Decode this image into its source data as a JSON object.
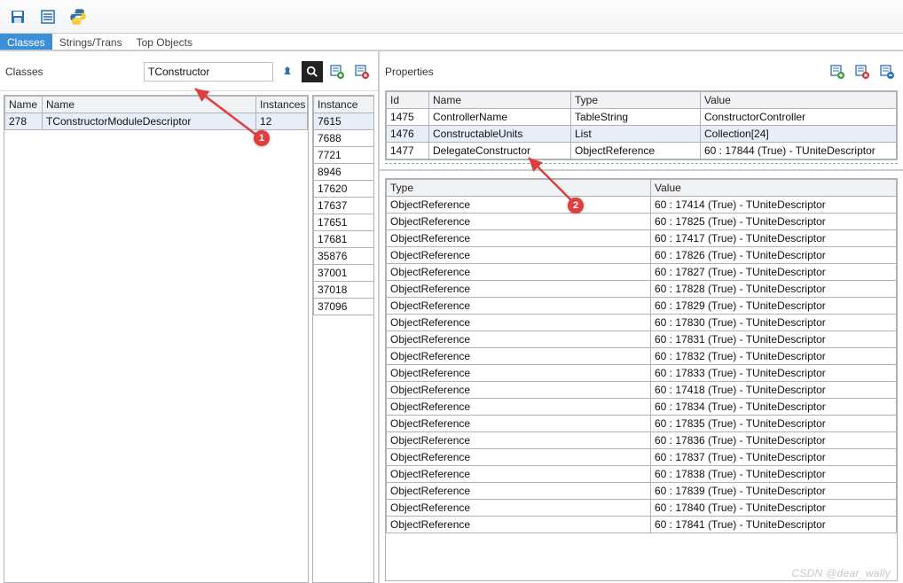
{
  "toolbar": {
    "save_icon": "save-icon",
    "list_icon": "list-icon",
    "python_icon": "python-icon"
  },
  "tabs": {
    "items": [
      {
        "label": "Classes",
        "active": true
      },
      {
        "label": "Strings/Trans",
        "active": false
      },
      {
        "label": "Top Objects",
        "active": false
      }
    ]
  },
  "classes_panel": {
    "title": "Classes",
    "filter_value": "TConstructor",
    "headers": {
      "name_short": "Name",
      "name": "Name",
      "instances": "Instances",
      "instance": "Instance"
    },
    "rows": [
      {
        "id": "278",
        "name": "TConstructorModuleDescriptor",
        "instances": "12"
      }
    ],
    "instance_ids": [
      "7615",
      "7688",
      "7721",
      "8946",
      "17620",
      "17637",
      "17651",
      "17681",
      "35876",
      "37001",
      "37018",
      "37096"
    ]
  },
  "properties_panel": {
    "title": "Properties",
    "headers": {
      "id": "Id",
      "name": "Name",
      "type": "Type",
      "value": "Value"
    },
    "rows": [
      {
        "id": "1475",
        "name": "ControllerName",
        "type": "TableString",
        "value": "ConstructorController"
      },
      {
        "id": "1476",
        "name": "ConstructableUnits",
        "type": "List",
        "value": "Collection[24]"
      },
      {
        "id": "1477",
        "name": "DelegateConstructor",
        "type": "ObjectReference",
        "value": "60 : 17844 (True) - TUniteDescriptor"
      }
    ]
  },
  "values_panel": {
    "headers": {
      "type": "Type",
      "value": "Value"
    },
    "rows": [
      {
        "type": "ObjectReference",
        "value": "60 : 17414 (True) - TUniteDescriptor"
      },
      {
        "type": "ObjectReference",
        "value": "60 : 17825 (True) - TUniteDescriptor"
      },
      {
        "type": "ObjectReference",
        "value": "60 : 17417 (True) - TUniteDescriptor"
      },
      {
        "type": "ObjectReference",
        "value": "60 : 17826 (True) - TUniteDescriptor"
      },
      {
        "type": "ObjectReference",
        "value": "60 : 17827 (True) - TUniteDescriptor"
      },
      {
        "type": "ObjectReference",
        "value": "60 : 17828 (True) - TUniteDescriptor"
      },
      {
        "type": "ObjectReference",
        "value": "60 : 17829 (True) - TUniteDescriptor"
      },
      {
        "type": "ObjectReference",
        "value": "60 : 17830 (True) - TUniteDescriptor"
      },
      {
        "type": "ObjectReference",
        "value": "60 : 17831 (True) - TUniteDescriptor"
      },
      {
        "type": "ObjectReference",
        "value": "60 : 17832 (True) - TUniteDescriptor"
      },
      {
        "type": "ObjectReference",
        "value": "60 : 17833 (True) - TUniteDescriptor"
      },
      {
        "type": "ObjectReference",
        "value": "60 : 17418 (True) - TUniteDescriptor"
      },
      {
        "type": "ObjectReference",
        "value": "60 : 17834 (True) - TUniteDescriptor"
      },
      {
        "type": "ObjectReference",
        "value": "60 : 17835 (True) - TUniteDescriptor"
      },
      {
        "type": "ObjectReference",
        "value": "60 : 17836 (True) - TUniteDescriptor"
      },
      {
        "type": "ObjectReference",
        "value": "60 : 17837 (True) - TUniteDescriptor"
      },
      {
        "type": "ObjectReference",
        "value": "60 : 17838 (True) - TUniteDescriptor"
      },
      {
        "type": "ObjectReference",
        "value": "60 : 17839 (True) - TUniteDescriptor"
      },
      {
        "type": "ObjectReference",
        "value": "60 : 17840 (True) - TUniteDescriptor"
      },
      {
        "type": "ObjectReference",
        "value": "60 : 17841 (True) - TUniteDescriptor"
      }
    ]
  },
  "annotations": {
    "badge1": "1",
    "badge2": "2"
  },
  "watermark": "CSDN @dear_wally"
}
